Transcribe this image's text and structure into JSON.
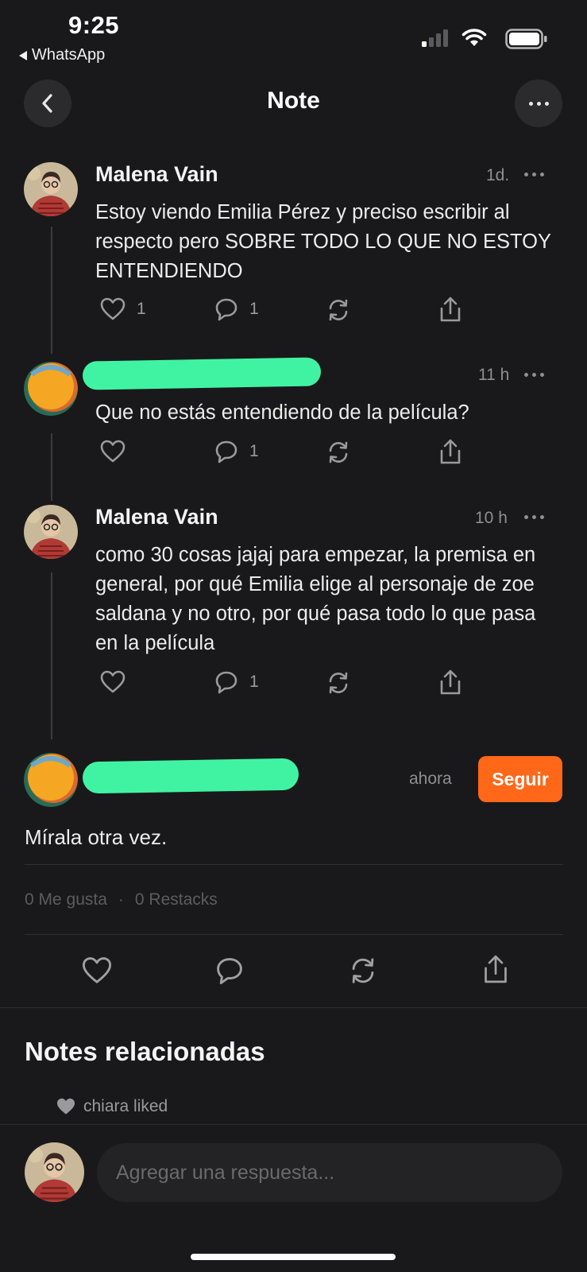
{
  "status_bar": {
    "time": "9:25",
    "back_app": "WhatsApp",
    "icons": [
      "signal-icon",
      "wifi-icon",
      "battery-icon"
    ]
  },
  "header": {
    "title": "Note",
    "back_icon": "chevron-left-icon",
    "more_icon": "more-horizontal-icon"
  },
  "thread": [
    {
      "author": "Malena Vain",
      "timestamp": "1d.",
      "text": "Estoy viendo Emilia Pérez y preciso escribir al respecto pero SOBRE TODO LO QUE NO ESTOY ENTENDIENDO",
      "likes": "1",
      "comments": "1"
    },
    {
      "author": "",
      "timestamp": "11 h",
      "text": "Que no estás entendiendo de la película?",
      "likes": "",
      "comments": "1"
    },
    {
      "author": "Malena Vain",
      "timestamp": "10 h",
      "text": "como 30 cosas jajaj para empezar, la premisa en general, por qué Emilia elige al personaje de zoe saldana y no otro, por qué pasa todo lo que pasa en la película",
      "likes": "",
      "comments": "1"
    }
  ],
  "main_note": {
    "timestamp": "ahora",
    "follow_label": "Seguir",
    "text": "Mírala otra vez.",
    "likes_stat": "0 Me gusta",
    "separator": "·",
    "restacks_stat": "0 Restacks"
  },
  "related": {
    "title": "Notes relacionadas",
    "liked_text": "chiara liked"
  },
  "reply": {
    "placeholder": "Agregar una respuesta..."
  },
  "colors": {
    "background": "#19191b",
    "accent": "#ff6719",
    "redaction": "#40f3a3"
  }
}
